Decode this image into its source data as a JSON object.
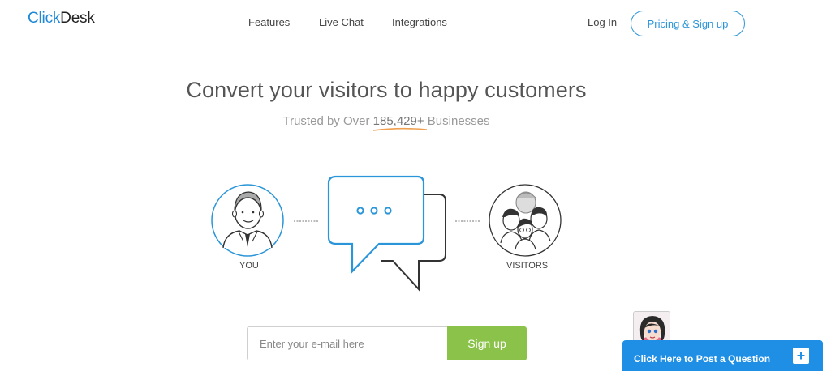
{
  "header": {
    "logo_part1": "Click",
    "logo_part2": "Desk",
    "nav": [
      {
        "label": "Features"
      },
      {
        "label": "Live Chat"
      },
      {
        "label": "Integrations"
      }
    ],
    "login_label": "Log In",
    "pricing_label": "Pricing & Sign up"
  },
  "hero": {
    "headline": "Convert your visitors to happy customers",
    "trusted_prefix": "Trusted by Over ",
    "trusted_count": "185,429+",
    "trusted_suffix": " Businesses"
  },
  "illustration": {
    "you_label": "YOU",
    "visitors_label": "VISITORS"
  },
  "signup": {
    "email_placeholder": "Enter your e-mail here",
    "button_label": "Sign up"
  },
  "chat_widget": {
    "label": "Click Here to Post a Question",
    "plus_icon": "+"
  },
  "colors": {
    "brand_blue": "#1e88d8",
    "signup_green": "#8bc34a",
    "widget_blue": "#1f8fe6",
    "underline_orange": "#f0a050"
  }
}
